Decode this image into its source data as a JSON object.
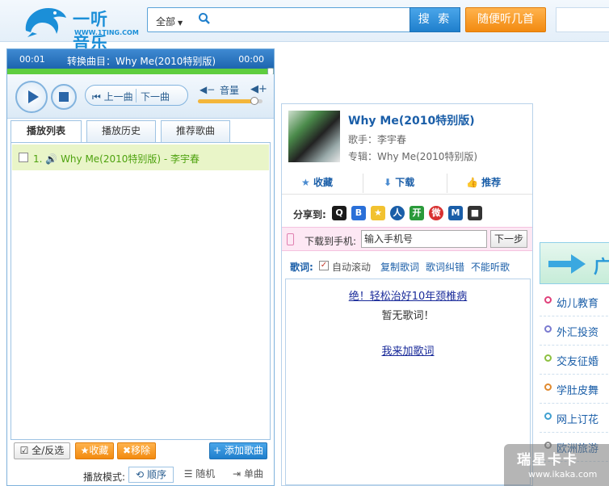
{
  "header": {
    "logo_text": "一听音乐",
    "logo_url": "WWW.1TING.COM",
    "search_category": "全部",
    "search_placeholder": "",
    "search_button": "搜 索",
    "random_button": "随便听几首"
  },
  "player": {
    "current_time": "00:01",
    "now_playing": "转换曲目：Why Me(2010特别版)",
    "total_time": "00:00",
    "progress": 1.0,
    "prev_label": "上一曲",
    "next_label": "下一曲",
    "volume_label": "音量",
    "volume": 0.88,
    "tabs": [
      {
        "label": "播放列表",
        "active": true
      },
      {
        "label": "播放历史",
        "active": false
      },
      {
        "label": "推荐歌曲",
        "active": false
      }
    ],
    "playlist": [
      {
        "index": "1.",
        "text": "Why Me(2010特别版) - 李宇春"
      }
    ],
    "footer": {
      "select_all": "全/反选",
      "favorite": "收藏",
      "remove": "移除",
      "add_song": "添加歌曲"
    },
    "mode": {
      "label": "播放模式:",
      "sequential": "顺序",
      "random": "随机",
      "single": "单曲"
    }
  },
  "song": {
    "title": "Why Me(2010特别版)",
    "singer": "歌手：李宇春",
    "album": "专辑：Why Me(2010特别版)",
    "actions": {
      "favorite": "收藏",
      "download": "下载",
      "recommend": "推荐"
    },
    "share_label": "分享到:",
    "mobile_label": "下载到手机:",
    "mobile_placeholder": "输入手机号",
    "mobile_next": "下一步",
    "lyrics_label": "歌词:",
    "auto_scroll": "自动滚动",
    "copy_lyrics": "复制歌词",
    "correct_lyrics": "歌词纠错",
    "cannot_play": "不能听歌",
    "lyric_ad": "绝！轻松治好10年颈椎病",
    "no_lyrics": "暂无歌词！",
    "add_lyrics": "我来加歌词"
  },
  "ads": {
    "banner_text": "广",
    "items": [
      {
        "label": "幼儿教育",
        "color": "#e0407a"
      },
      {
        "label": "外汇投资",
        "color": "#7a7ad0"
      },
      {
        "label": "交友征婚",
        "color": "#8dc040"
      },
      {
        "label": "学肚皮舞",
        "color": "#e08a30"
      },
      {
        "label": "网上订花",
        "color": "#40a0d0"
      },
      {
        "label": "欧洲旅游",
        "color": "#888888"
      }
    ]
  },
  "watermark": {
    "main": "瑞星卡卡",
    "url": "www.ikaka.com"
  },
  "colors": {
    "accent_blue": "#1f7fcc",
    "accent_orange": "#f28a10",
    "playlist_green": "#4ea20f"
  }
}
